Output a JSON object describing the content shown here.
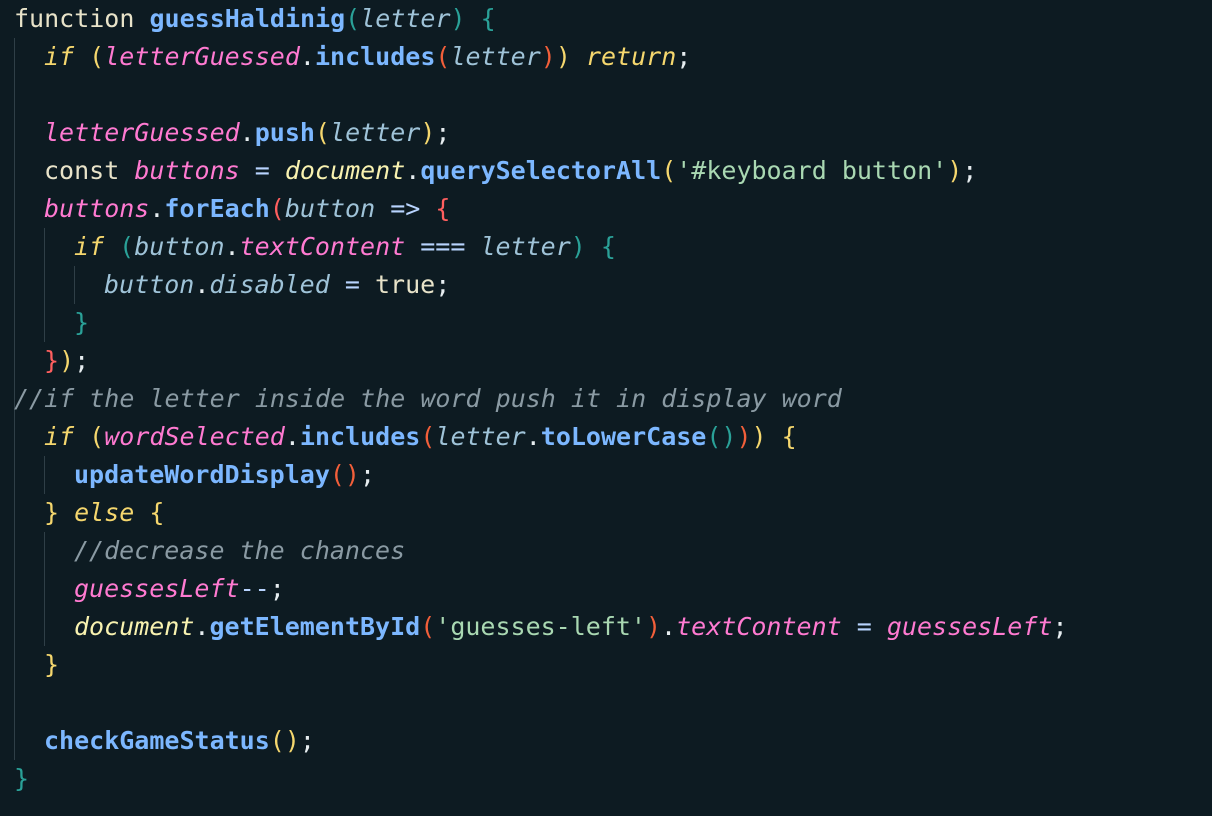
{
  "code": {
    "line1": {
      "kw": "function",
      "name": "guessHaldinig",
      "open": "(",
      "param": "letter",
      "close": ")",
      "brace": "{"
    },
    "line2": {
      "kw": "if",
      "open": "(",
      "var": "letterGuessed",
      "dot": ".",
      "fn": "includes",
      "p_open": "(",
      "arg": "letter",
      "p_close": ")",
      "close": ")",
      "ret": "return",
      "semi": ";"
    },
    "line3": {
      "var": "letterGuessed",
      "dot": ".",
      "fn": "push",
      "open": "(",
      "arg": "letter",
      "close": ")",
      "semi": ";"
    },
    "line4": {
      "kw": "const",
      "var": "buttons",
      "eq": "=",
      "obj": "document",
      "dot": ".",
      "fn": "querySelectorAll",
      "open": "(",
      "str": "'#keyboard button'",
      "close": ")",
      "semi": ";"
    },
    "line5": {
      "var": "buttons",
      "dot": ".",
      "fn": "forEach",
      "open": "(",
      "param": "button",
      "arrow": "=>",
      "brace": "{"
    },
    "line6": {
      "kw": "if",
      "open": "(",
      "obj": "button",
      "dot": ".",
      "prop": "textContent",
      "eq": "===",
      "arg": "letter",
      "close": ")",
      "brace": "{"
    },
    "line7": {
      "obj": "button",
      "dot": ".",
      "prop": "disabled",
      "eq": "=",
      "val": "true",
      "semi": ";"
    },
    "line8": {
      "brace": "}"
    },
    "line9": {
      "brace": "}",
      "close": ")",
      "semi": ";"
    },
    "line10": {
      "comment": "//if the letter inside the word push it in display word"
    },
    "line11": {
      "kw": "if",
      "open": "(",
      "var": "wordSelected",
      "dot1": ".",
      "fn1": "includes",
      "p_open": "(",
      "arg": "letter",
      "dot2": ".",
      "fn2": "toLowerCase",
      "call": "()",
      "p_close": ")",
      "close": ")",
      "brace": "{"
    },
    "line12": {
      "fn": "updateWordDisplay",
      "call": "()",
      "semi": ";"
    },
    "line13": {
      "close_brace": "}",
      "kw": "else",
      "brace": "{"
    },
    "line14": {
      "comment": "//decrease the chances"
    },
    "line15": {
      "var": "guessesLeft",
      "op": "--",
      "semi": ";"
    },
    "line16": {
      "obj": "document",
      "dot1": ".",
      "fn": "getElementById",
      "open": "(",
      "str": "'guesses-left'",
      "close": ")",
      "dot2": ".",
      "prop": "textContent",
      "eq": "=",
      "var": "guessesLeft",
      "semi": ";"
    },
    "line17": {
      "brace": "}"
    },
    "line18": {
      "fn": "checkGameStatus",
      "call": "()",
      "semi": ";"
    },
    "line19": {
      "brace": "}"
    }
  }
}
